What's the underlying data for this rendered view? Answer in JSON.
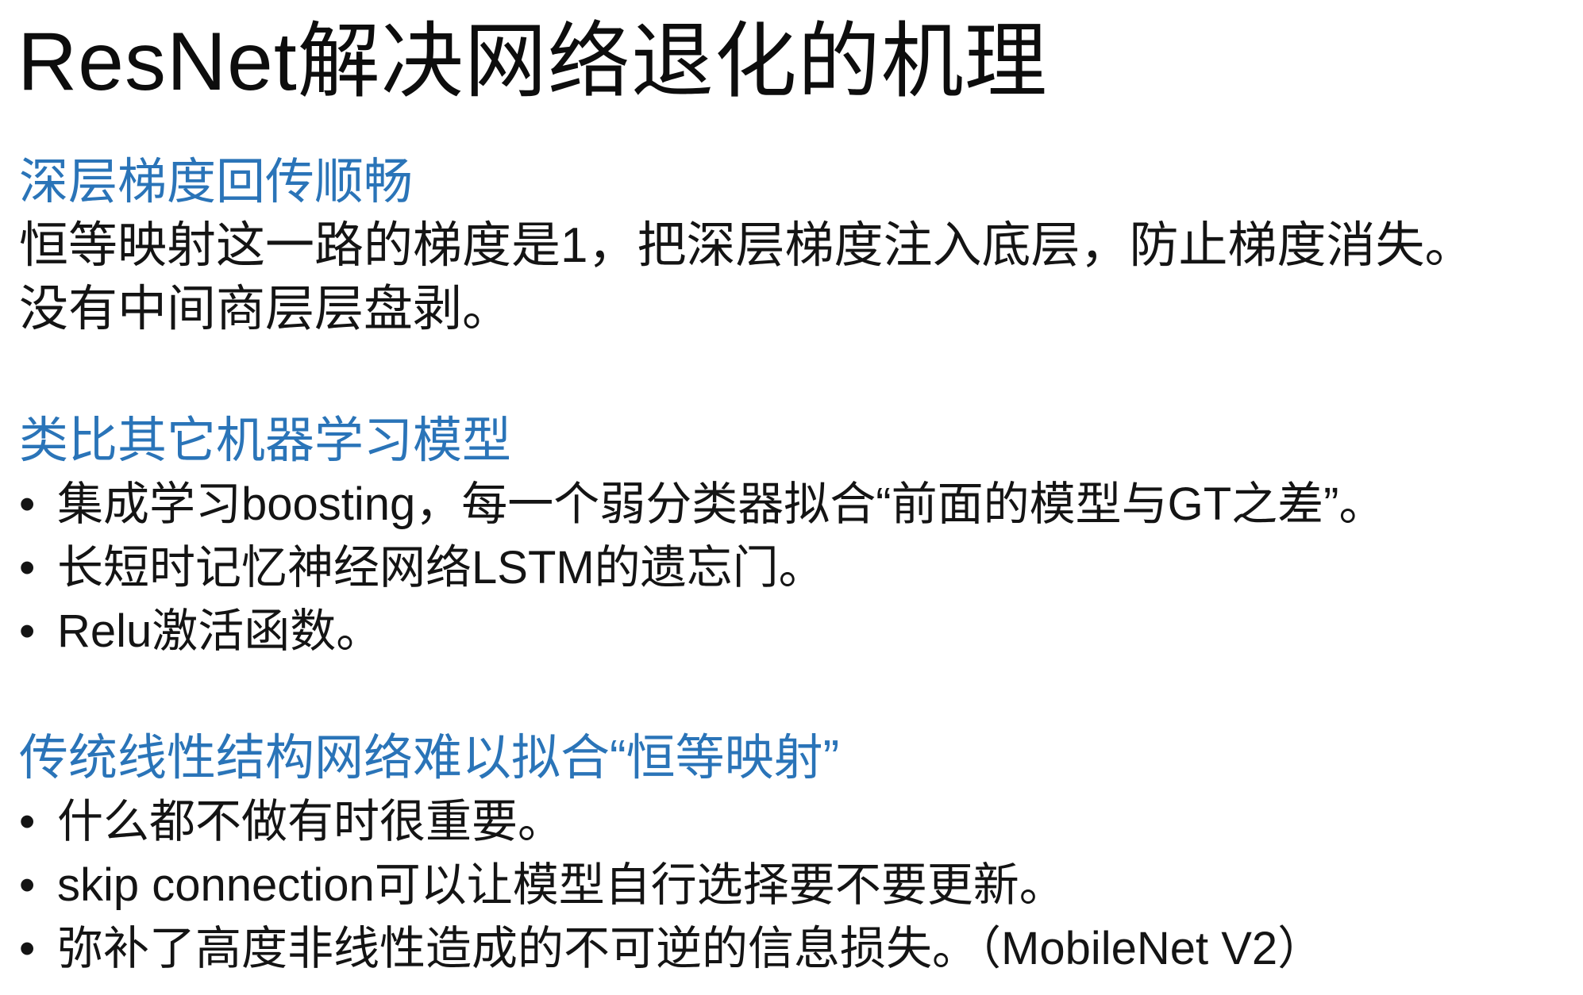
{
  "title": "ResNet解决网络退化的机理",
  "bullet_glyph": "•",
  "sections": [
    {
      "heading": "深层梯度回传顺畅",
      "paragraph_lines": [
        "恒等映射这一路的梯度是1，把深层梯度注入底层，防止梯度消失。",
        "没有中间商层层盘剥。"
      ]
    },
    {
      "heading": "类比其它机器学习模型",
      "bullets": [
        "集成学习boosting，每一个弱分类器拟合“前面的模型与GT之差”。",
        "长短时记忆神经网络LSTM的遗忘门。",
        "Relu激活函数。"
      ]
    },
    {
      "heading": "传统线性结构网络难以拟合“恒等映射”",
      "bullets": [
        "什么都不做有时很重要。",
        "skip connection可以让模型自行选择要不要更新。",
        "弥补了高度非线性造成的不可逆的信息损失。（MobileNet V2）"
      ]
    }
  ],
  "colors": {
    "heading_blue": "#2a74b8",
    "text": "#141414",
    "background": "#ffffff"
  }
}
